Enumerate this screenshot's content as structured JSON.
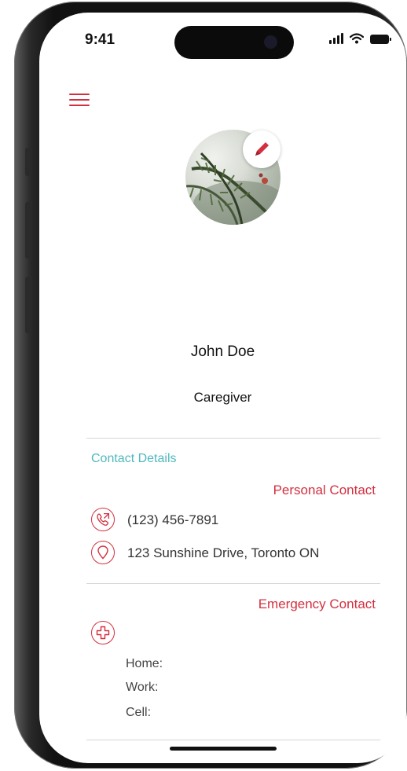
{
  "status_bar": {
    "time": "9:41"
  },
  "profile": {
    "name": "John Doe",
    "role": "Caregiver"
  },
  "contact_details": {
    "section_title": "Contact Details",
    "personal": {
      "heading": "Personal Contact",
      "phone": "(123) 456-7891",
      "address": "123 Sunshine Drive, Toronto ON"
    },
    "emergency": {
      "heading": "Emergency Contact",
      "home_label": "Home:",
      "work_label": "Work:",
      "cell_label": "Cell:"
    }
  },
  "icons": {
    "menu": "hamburger-menu-icon",
    "edit": "pencil-icon",
    "phone": "phone-call-icon",
    "location": "location-pin-icon",
    "emergency": "medical-cross-icon"
  },
  "colors": {
    "accent_red": "#d32f3f",
    "accent_teal": "#4fb8bf",
    "divider": "#d6d6d6"
  }
}
